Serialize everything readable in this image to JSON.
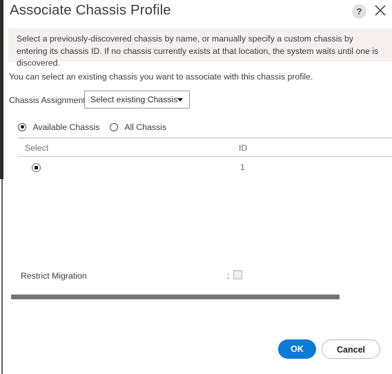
{
  "dialog": {
    "title": "Associate Chassis Profile",
    "help_icon": "?",
    "close_icon": "close-icon"
  },
  "info_banner": {
    "text": "Select a previously-discovered chassis by name, or manually specify a custom chassis by entering its chassis ID. If no chassis currently exists at that location, the system waits until one is discovered.",
    "background": "#f6f0f0"
  },
  "body": {
    "lead_text": "You can select an existing chassis you want to associate with this chassis profile."
  },
  "chassis_assignment": {
    "label": "Chassis Assignment:",
    "dropdown_value": "Select existing Chassis",
    "options": [
      "Select existing Chassis"
    ]
  },
  "scope_radios": {
    "items": [
      {
        "label": "Available Chassis",
        "selected": true
      },
      {
        "label": "All Chassis",
        "selected": false
      }
    ]
  },
  "table": {
    "columns": [
      "Select",
      "ID"
    ],
    "rows": [
      {
        "selected": true,
        "id": "1"
      }
    ]
  },
  "restrict_migration": {
    "label": "Restrict Migration",
    "separator": ":",
    "checked": false
  },
  "footer": {
    "ok_label": "OK",
    "cancel_label": "Cancel",
    "ok_color": "#0d7bd4"
  }
}
